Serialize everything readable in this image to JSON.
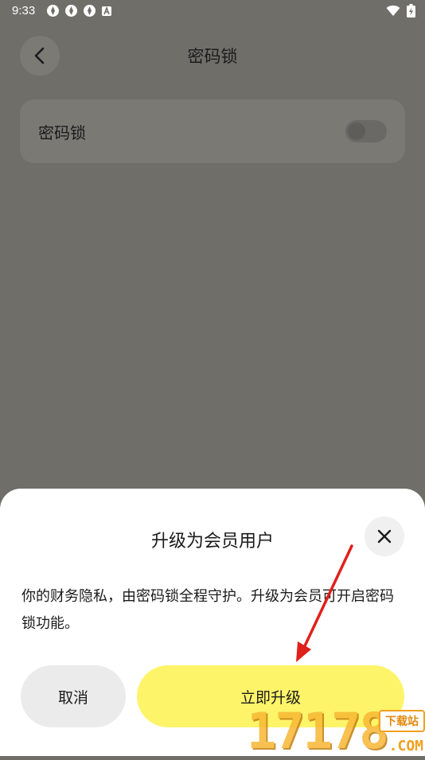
{
  "status_bar": {
    "time": "9:33",
    "notification_icons": [
      "app-notification-icon",
      "app-notification-icon",
      "app-notification-icon",
      "a-notification-icon"
    ],
    "wifi_icon": "wifi-icon",
    "battery_icon": "battery-charging-icon"
  },
  "header": {
    "title": "密码锁",
    "back_icon": "chevron-left-icon"
  },
  "settings": {
    "password_lock_label": "密码锁",
    "password_lock_enabled": false
  },
  "dialog": {
    "title": "升级为会员用户",
    "close_icon": "close-icon",
    "message": "你的财务隐私，由密码锁全程守护。升级为会员可开启密码锁功能。",
    "cancel_label": "取消",
    "upgrade_label": "立即升级",
    "upgrade_color": "#fef46a"
  },
  "watermark": {
    "digits": "17178",
    "tag": "下载站",
    "domain": ".COM"
  },
  "colors": {
    "overlay": "#6f6e69",
    "sheet": "#ffffff",
    "annotation_arrow": "#e0201a"
  }
}
